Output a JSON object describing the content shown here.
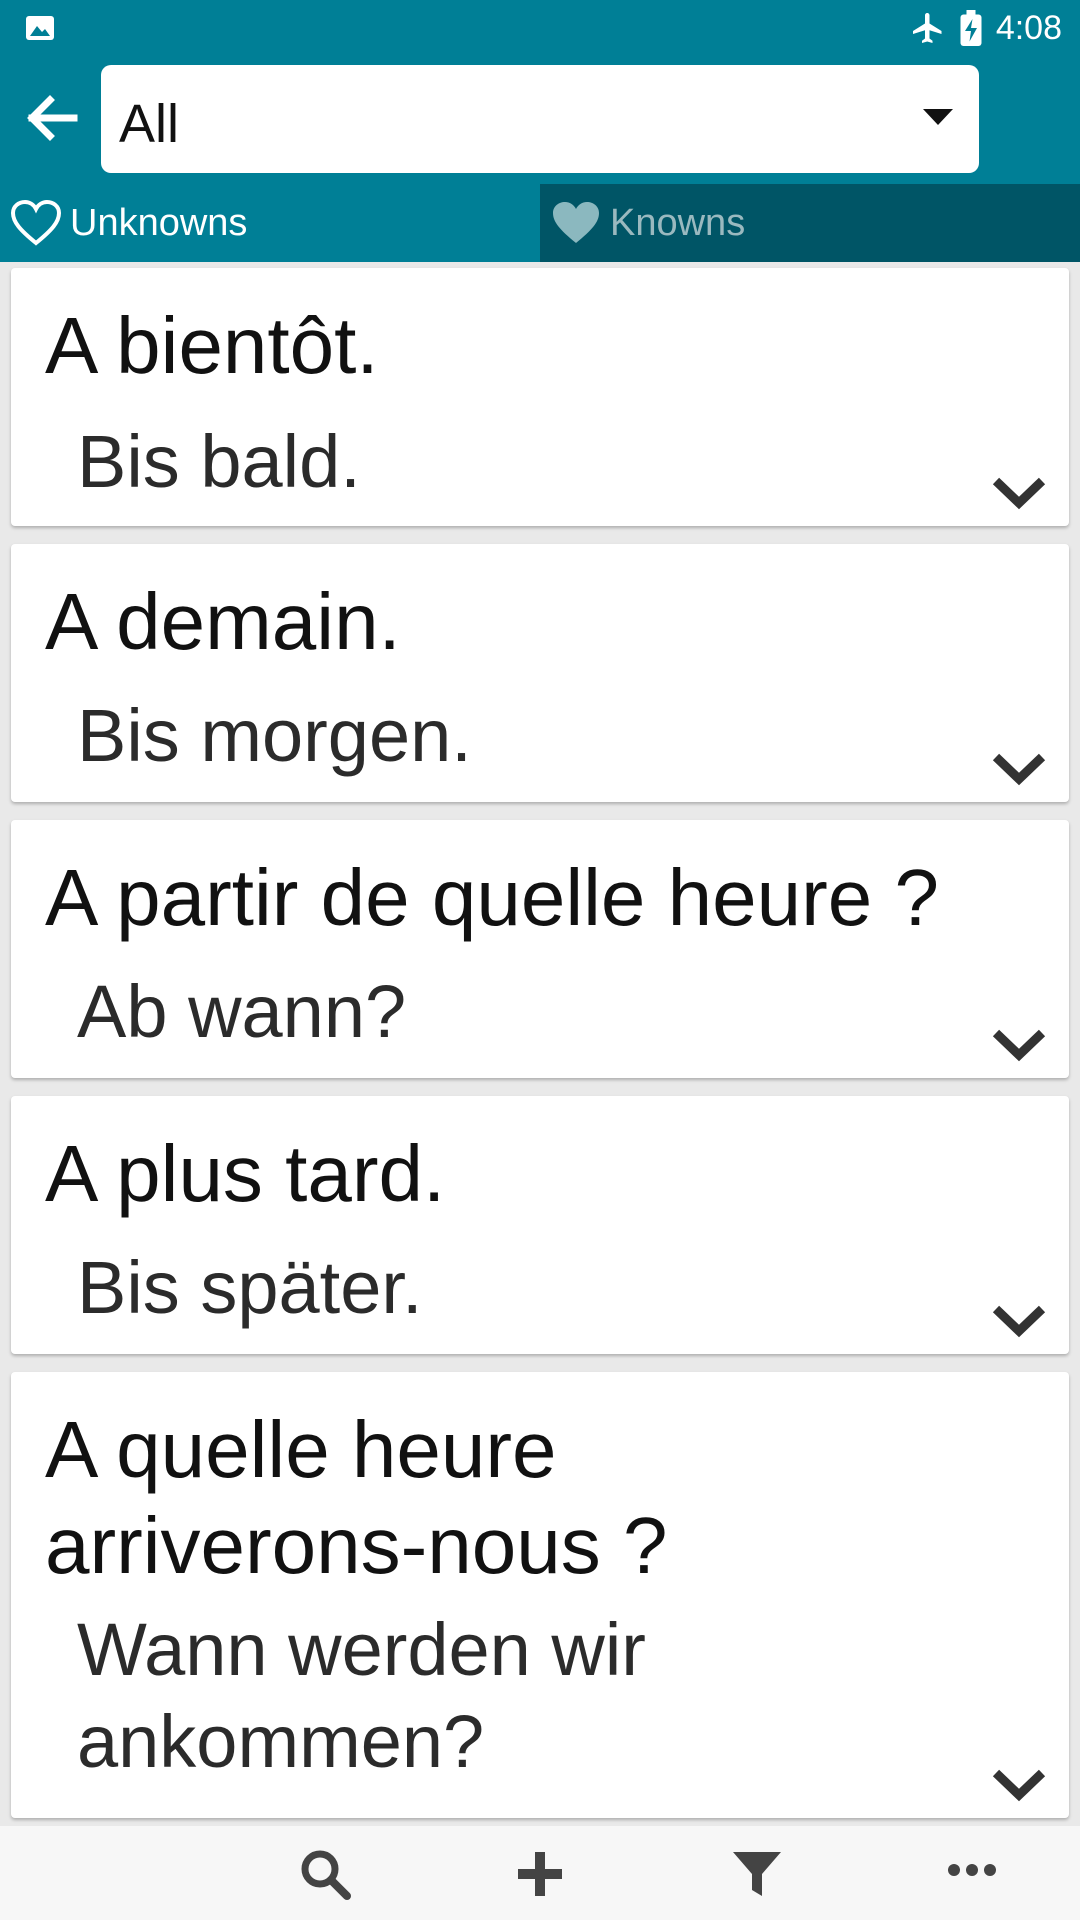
{
  "status": {
    "time": "4:08",
    "icons": [
      "image-icon",
      "airplane-mode-icon",
      "battery-charging-icon"
    ]
  },
  "toolbar": {
    "back_icon": "arrow-left-icon",
    "dropdown_value": "All",
    "dropdown_icon": "caret-down-icon"
  },
  "tabs": {
    "unknowns": {
      "label": "Unknowns",
      "icon": "heart-outline-icon"
    },
    "knowns": {
      "label": "Knowns",
      "icon": "heart-filled-icon"
    }
  },
  "cards": [
    {
      "fr": "A bientôt.",
      "de": "Bis bald."
    },
    {
      "fr": "A demain.",
      "de": "Bis morgen."
    },
    {
      "fr": "A partir de quelle heure ?",
      "de": "Ab wann?"
    },
    {
      "fr": "A plus tard.",
      "de": "Bis später."
    },
    {
      "fr_line1": "A quelle heure",
      "fr_line2": "arriverons-nous ?",
      "de_line1": "Wann werden wir",
      "de_line2": "ankommen?"
    }
  ],
  "bottom_bar": {
    "icons": [
      "search-icon",
      "add-icon",
      "filter-icon",
      "more-icon"
    ]
  },
  "colors": {
    "primary": "#007f96",
    "tab_selected_dark": "#005566",
    "card_bg": "#ffffff",
    "list_bg": "#e9e9e9"
  }
}
